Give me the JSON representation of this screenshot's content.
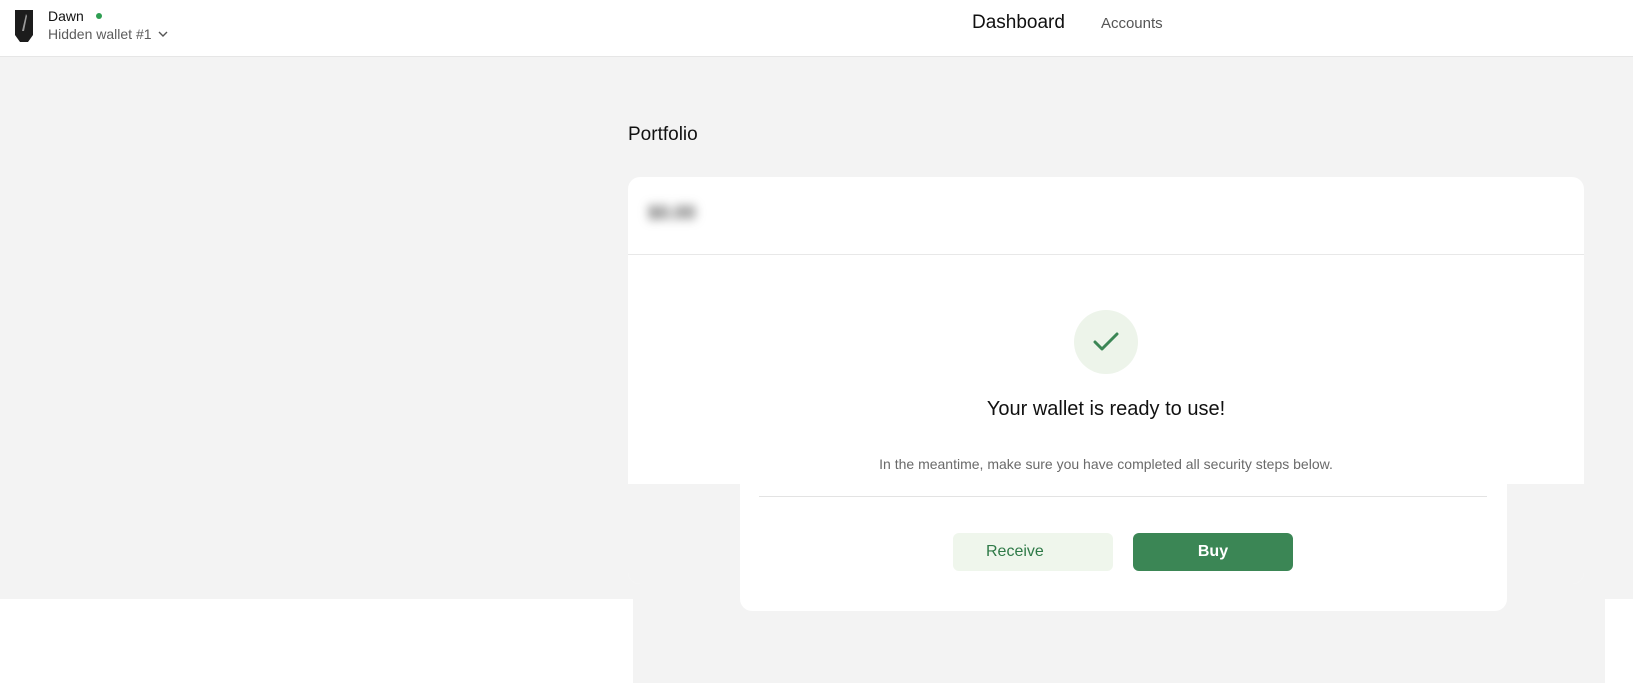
{
  "header": {
    "device_name": "Dawn",
    "wallet_name": "Hidden wallet #1",
    "nav": [
      {
        "label": "Dashboard",
        "active": true
      },
      {
        "label": "Accounts",
        "active": false
      }
    ]
  },
  "portfolio": {
    "title": "Portfolio",
    "balance": "$0.00"
  },
  "success": {
    "title": "Your wallet is ready to use!",
    "subtitle": "In the meantime, make sure you have completed all security steps below.",
    "receive_label": "Receive",
    "buy_label": "Buy"
  },
  "colors": {
    "accent_green": "#3b8655",
    "status_connected": "#2e9e52",
    "background": "#f3f3f3"
  },
  "icons": [
    "trezor-device-icon",
    "chevron-down-icon",
    "checkmark-icon"
  ]
}
